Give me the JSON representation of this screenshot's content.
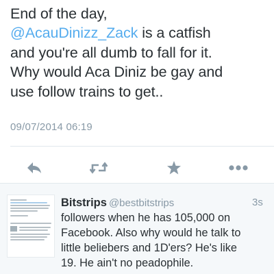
{
  "tweet": {
    "lines": [
      {
        "text": "End of the day,"
      },
      {
        "mention": "@AcauDinizz_Zack",
        "rest": " is a catfish"
      },
      {
        "text": "and you're all dumb to fall for it."
      },
      {
        "text": "Why would Aca Diniz be gay and"
      },
      {
        "text": "use follow trains to get.."
      }
    ],
    "timestamp": "09/07/2014 06:19"
  },
  "actions": {
    "reply_icon": "reply-arrow-icon",
    "retweet_icon": "retweet-icon",
    "favorite_icon": "star-icon",
    "more_icon": "more-dots-icon",
    "icon_color": "#8899a6"
  },
  "reply": {
    "name": "Bitstrips",
    "handle": "@bestbitstrips",
    "time": "3s",
    "lines": [
      "followers when he has 105,000 on",
      "Facebook. Also why would he talk to",
      "little beliebers and 1D'ers? He's like",
      "19. He ain't no peadophile."
    ],
    "thumbnail": "tweet-screenshot-image"
  },
  "colors": {
    "link": "#55acee",
    "muted": "#8899a6",
    "text": "#292f33",
    "feed_bg": "#f5f8fa",
    "divider": "#e1e8ed"
  }
}
